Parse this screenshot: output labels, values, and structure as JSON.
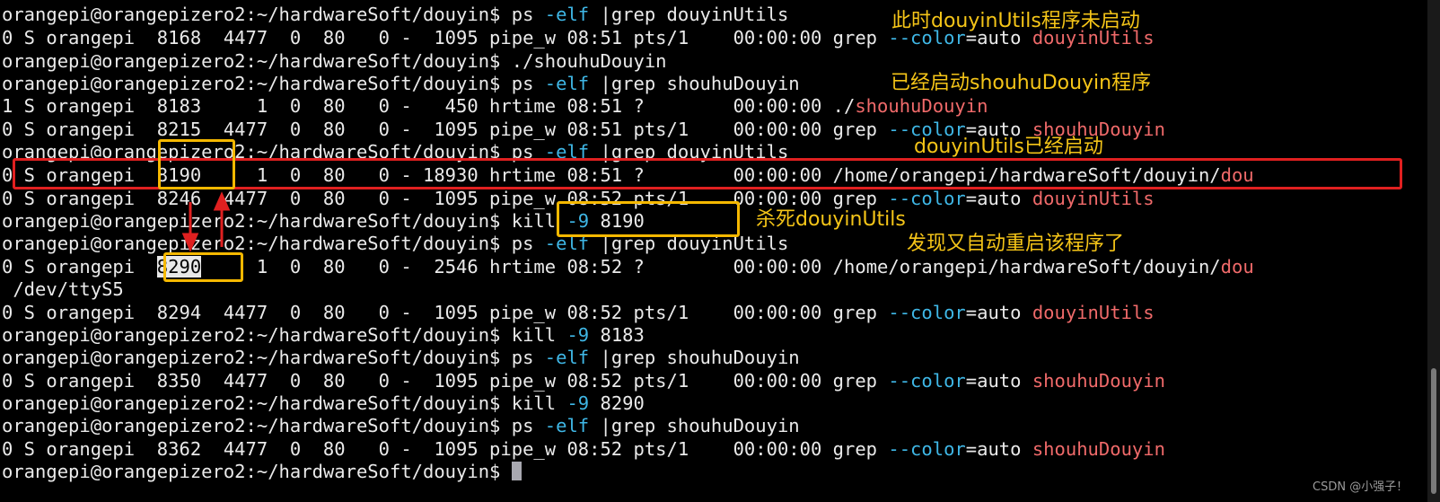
{
  "terminal": {
    "lines": [
      [
        {
          "t": "orangepi@orangepizero2:~/hardwareSoft/douyin$ ps "
        },
        {
          "t": "-elf",
          "c": "cyan"
        },
        {
          "t": " |grep douyinUtils"
        }
      ],
      [
        {
          "t": "0 S orangepi  8168  4477  0  80   0 -  1095 pipe_w 08:51 pts/1    00:00:00 grep "
        },
        {
          "t": "--color",
          "c": "cyan"
        },
        {
          "t": "=auto "
        },
        {
          "t": "douyinUtils",
          "c": "red"
        }
      ],
      [
        {
          "t": "orangepi@orangepizero2:~/hardwareSoft/douyin$ ./shouhuDouyin"
        }
      ],
      [
        {
          "t": "orangepi@orangepizero2:~/hardwareSoft/douyin$ ps "
        },
        {
          "t": "-elf",
          "c": "cyan"
        },
        {
          "t": " |grep shouhuDouyin"
        }
      ],
      [
        {
          "t": "1 S orangepi  8183     1  0  80   0 -   450 hrtime 08:51 ?        00:00:00 ./"
        },
        {
          "t": "shouhuDouyin",
          "c": "red"
        }
      ],
      [
        {
          "t": "0 S orangepi  8215  4477  0  80   0 -  1095 pipe_w 08:51 pts/1    00:00:00 grep "
        },
        {
          "t": "--color",
          "c": "cyan"
        },
        {
          "t": "=auto "
        },
        {
          "t": "shouhuDouyin",
          "c": "red"
        }
      ],
      [
        {
          "t": "orangepi@orangepizero2:~/hardwareSoft/douyin$ ps "
        },
        {
          "t": "-elf",
          "c": "cyan"
        },
        {
          "t": " |grep douyinUtils"
        }
      ],
      [
        {
          "t": "0 S orangepi  8190     1  0  80   0 - 18930 hrtime 08:51 ?        00:00:00 /home/orangepi/hardwareSoft/douyin/"
        },
        {
          "t": "dou",
          "c": "red"
        }
      ],
      [
        {
          "t": "0 S orangepi  8246  4477  0  80   0 -  1095 pipe_w 08:52 pts/1    00:00:00 grep "
        },
        {
          "t": "--color",
          "c": "cyan"
        },
        {
          "t": "=auto "
        },
        {
          "t": "douyinUtils",
          "c": "red"
        }
      ],
      [
        {
          "t": "orangepi@orangepizero2:~/hardwareSoft/douyin$ kill "
        },
        {
          "t": "-9",
          "c": "cyan"
        },
        {
          "t": " 8190"
        }
      ],
      [
        {
          "t": "orangepi@orangepizero2:~/hardwareSoft/douyin$ ps "
        },
        {
          "t": "-elf",
          "c": "cyan"
        },
        {
          "t": " |grep douyinUtils"
        }
      ],
      [
        {
          "t": "0 S orangepi  "
        },
        {
          "t": "8290",
          "c": "sel"
        },
        {
          "t": "     1  0  80   0 -  2546 hrtime 08:52 ?        00:00:00 /home/orangepi/hardwareSoft/douyin/"
        },
        {
          "t": "dou",
          "c": "red"
        }
      ],
      [
        {
          "t": " /dev/ttyS5"
        }
      ],
      [
        {
          "t": "0 S orangepi  8294  4477  0  80   0 -  1095 pipe_w 08:52 pts/1    00:00:00 grep "
        },
        {
          "t": "--color",
          "c": "cyan"
        },
        {
          "t": "=auto "
        },
        {
          "t": "douyinUtils",
          "c": "red"
        }
      ],
      [
        {
          "t": "orangepi@orangepizero2:~/hardwareSoft/douyin$ kill "
        },
        {
          "t": "-9",
          "c": "cyan"
        },
        {
          "t": " 8183"
        }
      ],
      [
        {
          "t": "orangepi@orangepizero2:~/hardwareSoft/douyin$ ps "
        },
        {
          "t": "-elf",
          "c": "cyan"
        },
        {
          "t": " |grep shouhuDouyin"
        }
      ],
      [
        {
          "t": "0 S orangepi  8350  4477  0  80   0 -  1095 pipe_w 08:52 pts/1    00:00:00 grep "
        },
        {
          "t": "--color",
          "c": "cyan"
        },
        {
          "t": "=auto "
        },
        {
          "t": "shouhuDouyin",
          "c": "red"
        }
      ],
      [
        {
          "t": "orangepi@orangepizero2:~/hardwareSoft/douyin$ kill "
        },
        {
          "t": "-9",
          "c": "cyan"
        },
        {
          "t": " 8290"
        }
      ],
      [
        {
          "t": "orangepi@orangepizero2:~/hardwareSoft/douyin$ ps "
        },
        {
          "t": "-elf",
          "c": "cyan"
        },
        {
          "t": " |grep shouhuDouyin"
        }
      ],
      [
        {
          "t": "0 S orangepi  8362  4477  0  80   0 -  1095 pipe_w 08:52 pts/1    00:00:00 grep "
        },
        {
          "t": "--color",
          "c": "cyan"
        },
        {
          "t": "=auto "
        },
        {
          "t": "shouhuDouyin",
          "c": "red"
        }
      ],
      [
        {
          "t": "orangepi@orangepizero2:~/hardwareSoft/douyin$ "
        },
        {
          "t": "",
          "c": "cursor"
        }
      ]
    ]
  },
  "annotations": {
    "not_started": "此时douyinUtils程序未启动",
    "shouhu_started": "已经启动shouhuDouyin程序",
    "utils_started": "douyinUtils已经启动",
    "kill_utils": "杀死douyinUtils",
    "auto_restart": "发现又自动重启该程序了"
  },
  "watermark": "CSDN @小强子！",
  "colors": {
    "background": "#000000",
    "text": "#eaeaea",
    "option_cyan": "#3fb7e6",
    "match_red": "#f06a6a",
    "annotation_yellow": "#f5c518",
    "box_yellow": "#f5b800",
    "box_red": "#e02020"
  }
}
